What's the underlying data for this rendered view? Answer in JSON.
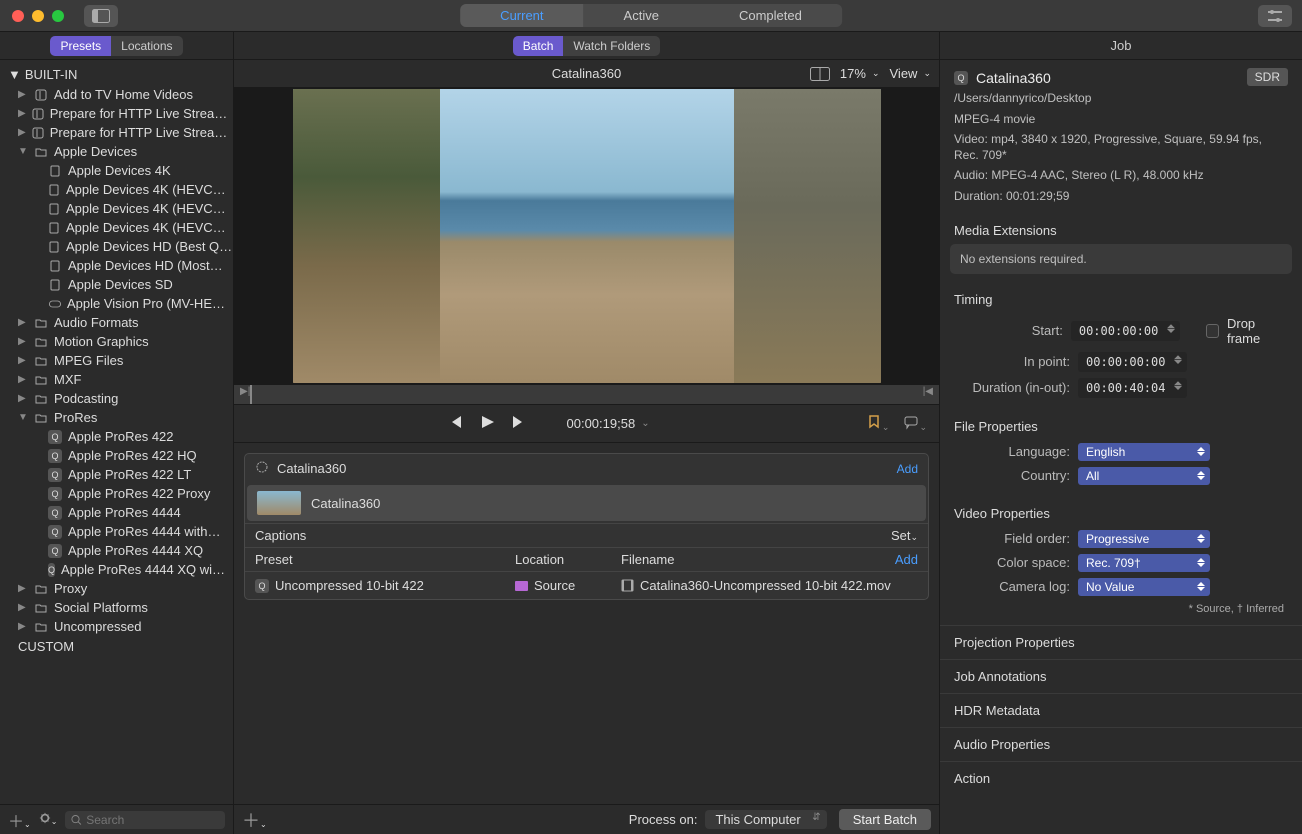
{
  "titlebar": {
    "segments": [
      "Current",
      "Active",
      "Completed"
    ]
  },
  "sidebar": {
    "tabs": [
      "Presets",
      "Locations"
    ],
    "sections": {
      "builtin": "BUILT-IN",
      "custom": "CUSTOM"
    },
    "groups": {
      "tvhome": "Add to TV Home Videos",
      "http1": "Prepare for HTTP Live Strea…",
      "http2": "Prepare for HTTP Live Strea…",
      "apple": "Apple Devices",
      "audio": "Audio Formats",
      "motion": "Motion Graphics",
      "mpeg": "MPEG Files",
      "mxf": "MXF",
      "podcast": "Podcasting",
      "prores": "ProRes",
      "proxy": "Proxy",
      "social": "Social Platforms",
      "uncomp": "Uncompressed"
    },
    "apple_children": [
      "Apple Devices 4K",
      "Apple Devices 4K (HEVC…",
      "Apple Devices 4K (HEVC…",
      "Apple Devices 4K (HEVC…",
      "Apple Devices HD (Best Q…",
      "Apple Devices HD (Most…",
      "Apple Devices SD",
      "Apple Vision Pro (MV-HE…"
    ],
    "prores_children": [
      "Apple ProRes 422",
      "Apple ProRes 422 HQ",
      "Apple ProRes 422 LT",
      "Apple ProRes 422 Proxy",
      "Apple ProRes 4444",
      "Apple ProRes 4444 with…",
      "Apple ProRes 4444 XQ",
      "Apple ProRes 4444 XQ wi…"
    ],
    "search_placeholder": "Search"
  },
  "center": {
    "tabs": [
      "Batch",
      "Watch Folders"
    ],
    "preview_title": "Catalina360",
    "zoom": "17%",
    "view_label": "View",
    "timecode": "00:00:19;58",
    "job": {
      "title": "Catalina360",
      "add": "Add",
      "source": "Catalina360",
      "captions": "Captions",
      "set": "Set",
      "cols": {
        "preset": "Preset",
        "location": "Location",
        "filename": "Filename"
      },
      "row": {
        "preset": "Uncompressed 10-bit 422",
        "location": "Source",
        "filename": "Catalina360-Uncompressed 10-bit 422.mov"
      }
    },
    "footer": {
      "process_label": "Process on:",
      "process_value": "This Computer",
      "start": "Start Batch"
    }
  },
  "inspector": {
    "tab": "Job",
    "title": "Catalina360",
    "sdr": "SDR",
    "path": "/Users/dannyrico/Desktop",
    "format": "MPEG-4 movie",
    "video": "Video: mp4, 3840 x 1920, Progressive, Square, 59.94 fps, Rec. 709*",
    "audio": "Audio: MPEG-4 AAC, Stereo (L R), 48.000 kHz",
    "duration": "Duration: 00:01:29;59",
    "media_ext_title": "Media Extensions",
    "media_ext_msg": "No extensions required.",
    "timing": {
      "title": "Timing",
      "start_label": "Start:",
      "start": "00:00:00:00",
      "dropframe": "Drop frame",
      "inpoint_label": "In point:",
      "inpoint": "00:00:00:00",
      "dur_label": "Duration (in-out):",
      "dur": "00:00:40:04"
    },
    "fileprops": {
      "title": "File Properties",
      "lang_label": "Language:",
      "lang": "English",
      "country_label": "Country:",
      "country": "All"
    },
    "videoprops": {
      "title": "Video Properties",
      "field_label": "Field order:",
      "field": "Progressive",
      "colorspace_label": "Color space:",
      "colorspace": "Rec. 709†",
      "cameralog_label": "Camera log:",
      "cameralog": "No Value",
      "footnote": "* Source, † Inferred"
    },
    "collapsibles": [
      "Projection Properties",
      "Job Annotations",
      "HDR Metadata",
      "Audio Properties",
      "Action"
    ]
  }
}
